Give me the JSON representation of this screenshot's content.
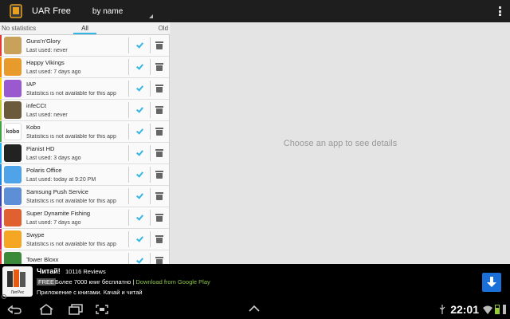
{
  "app": {
    "title": "UAR Free",
    "sort_label": "by name"
  },
  "filter_tabs": [
    {
      "label": "No statistics"
    },
    {
      "label": "All",
      "selected": true
    },
    {
      "label": "Old"
    }
  ],
  "apps": [
    {
      "name": "Guns'n'Glory",
      "status": "Last used: never",
      "stripe": "#e53935",
      "icon": "game-soldier-icon",
      "icon_color": "#c8a25a",
      "checked": true
    },
    {
      "name": "Happy Vikings",
      "status": "Last used: 7 days ago",
      "stripe": "#fb8c00",
      "icon": "viking-icon",
      "icon_color": "#e89a2b",
      "checked": true
    },
    {
      "name": "IAP",
      "status": "Statistics is not available for this app",
      "stripe": "#ffd600",
      "icon": "iap-icon",
      "icon_color": "#9b59d0",
      "checked": true
    },
    {
      "name": "infeCCt",
      "status": "Last used: never",
      "stripe": "#c0ca33",
      "icon": "game-board-icon",
      "icon_color": "#6b5b3a",
      "checked": true
    },
    {
      "name": "Kobo",
      "status": "Statistics is not available for this app",
      "stripe": "#43a047",
      "icon": "kobo-logo-icon",
      "icon_color": "#ffffff",
      "icon_text": "kobo",
      "checked": true
    },
    {
      "name": "Pianist HD",
      "status": "Last used: 3 days ago",
      "stripe": "#29b6f6",
      "icon": "piano-icon",
      "icon_color": "#222222",
      "checked": true
    },
    {
      "name": "Polaris Office",
      "status": "Last used: today at 9:20 PM",
      "stripe": "#1e88e5",
      "icon": "office-files-icon",
      "icon_color": "#4fa3e8",
      "checked": true
    },
    {
      "name": "Samsung Push Service",
      "status": "Statistics is not available for this app",
      "stripe": "#3949ab",
      "icon": "push-arrows-icon",
      "icon_color": "#5c8fd6",
      "checked": true
    },
    {
      "name": "Super Dynamite Fishing",
      "status": "Last used: 7 days ago",
      "stripe": "#8e24aa",
      "icon": "fishing-icon",
      "icon_color": "#e06030",
      "checked": true
    },
    {
      "name": "Swype",
      "status": "Statistics is not available for this app",
      "stripe": "#d81b60",
      "icon": "swype-icon",
      "icon_color": "#f5a623",
      "checked": true
    },
    {
      "name": "Tower Bloxx",
      "status": "",
      "stripe": "#e53935",
      "icon": "tower-icon",
      "icon_color": "#3a8a3a",
      "checked": true
    }
  ],
  "detail": {
    "empty_message": "Choose an app to see details"
  },
  "ad": {
    "title": "Читай!",
    "reviews": "10116 Reviews",
    "free_badge": "FREE",
    "line1": "Более 7000 книг бесплатно |",
    "play_link": "Download from Google Play",
    "line2": "Приложение с книгами. Качай и читай",
    "logo_text": "ЛитРес"
  },
  "status_bar": {
    "time": "22:01"
  }
}
